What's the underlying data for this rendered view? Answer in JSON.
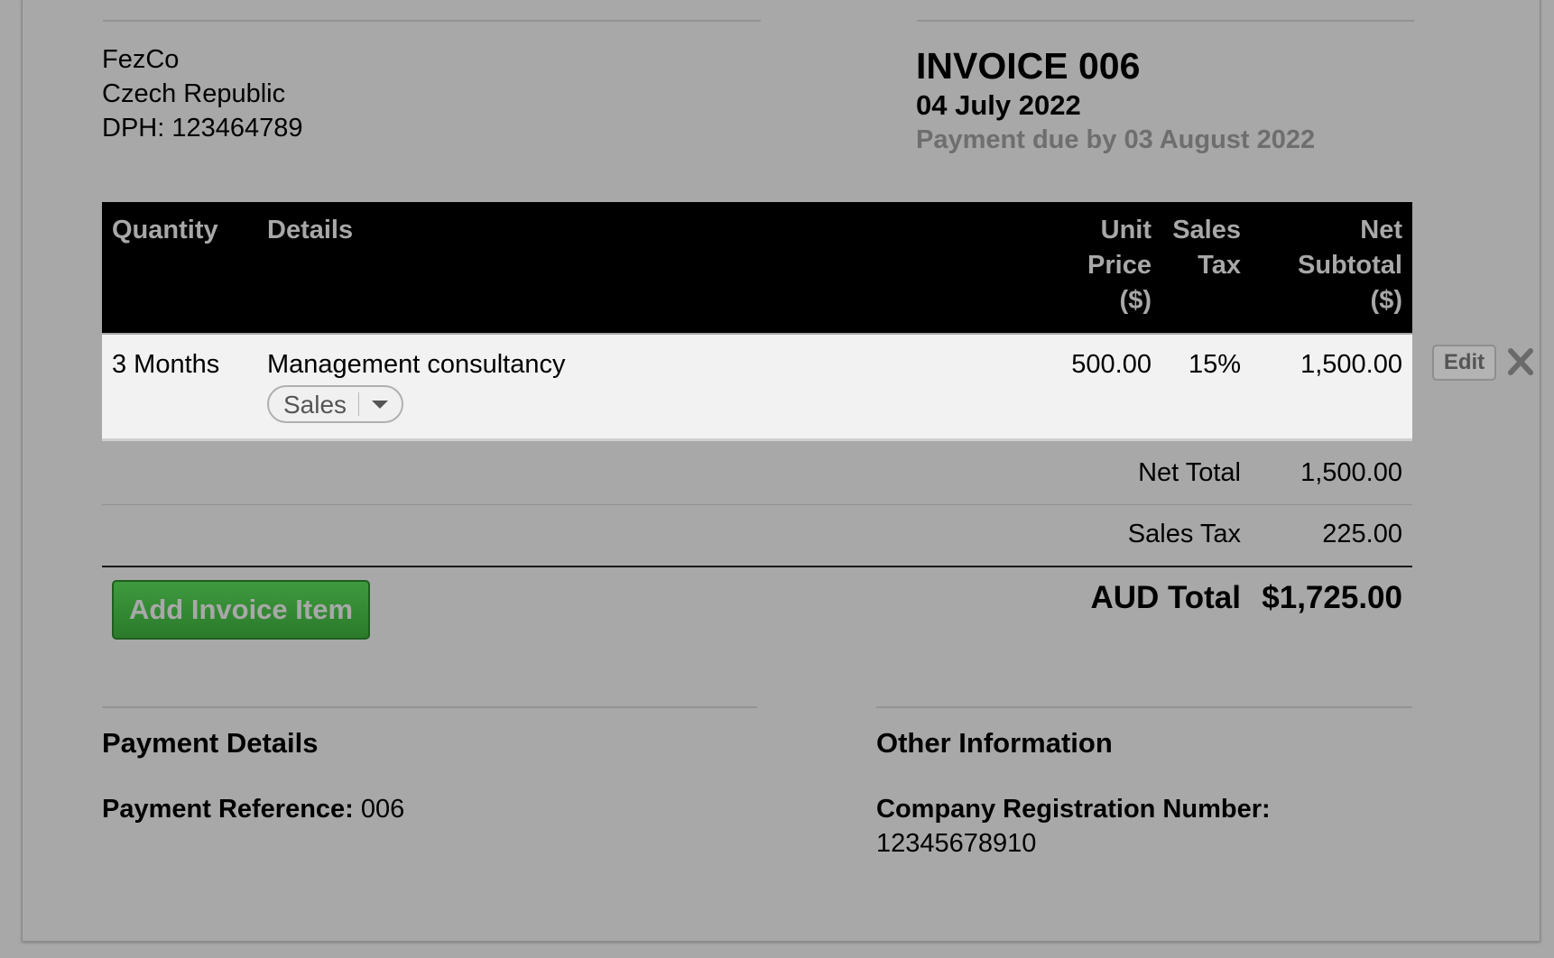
{
  "seller": {
    "name": "FezCo",
    "country": "Czech Republic",
    "tax_id": "DPH: 123464789"
  },
  "invoice": {
    "title": "INVOICE 006",
    "date": "04 July 2022",
    "due": "Payment due by 03 August 2022"
  },
  "table": {
    "headers": {
      "quantity": "Quantity",
      "details": "Details",
      "unit_price_1": "Unit",
      "unit_price_2": "Price",
      "unit_price_3": "($)",
      "sales_tax_1": "Sales",
      "sales_tax_2": "Tax",
      "net_subtotal_1": "Net",
      "net_subtotal_2": "Subtotal",
      "net_subtotal_3": "($)"
    },
    "rows": [
      {
        "quantity": "3 Months",
        "details": "Management consultancy",
        "category": "Sales",
        "unit_price": "500.00",
        "sales_tax": "15%",
        "net_subtotal": "1,500.00",
        "edit_label": "Edit"
      }
    ]
  },
  "totals": {
    "net_total_label": "Net Total",
    "net_total_value": "1,500.00",
    "sales_tax_label": "Sales Tax",
    "sales_tax_value": "225.00",
    "grand_total_label": "AUD Total",
    "grand_total_value": "$1,725.00"
  },
  "actions": {
    "add_item_label": "Add Invoice Item"
  },
  "payment_details": {
    "title": "Payment Details",
    "reference_label": "Payment Reference:",
    "reference_value": "006"
  },
  "other_information": {
    "title": "Other Information",
    "crn_label": "Company Registration Number:",
    "crn_value": "12345678910"
  },
  "colors": {
    "page_bg": "#a8a8a8",
    "header_bg": "#000000",
    "row_bg": "#f2f2f2",
    "add_button": "#2f842f",
    "muted_text": "#6e6e6e"
  },
  "icons": {
    "remove": "close-icon",
    "dropdown": "chevron-down-icon"
  }
}
